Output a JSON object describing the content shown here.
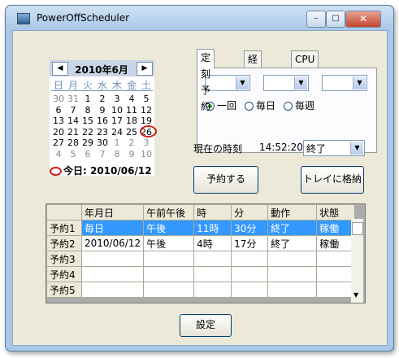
{
  "window": {
    "title": "PowerOffScheduler"
  },
  "calendar": {
    "month_label": "2010年6月",
    "weekdays": [
      "日",
      "月",
      "火",
      "水",
      "木",
      "金",
      "土"
    ],
    "weeks": [
      [
        "30",
        "31",
        "1",
        "2",
        "3",
        "4",
        "5"
      ],
      [
        "6",
        "7",
        "8",
        "9",
        "10",
        "11",
        "12"
      ],
      [
        "13",
        "14",
        "15",
        "16",
        "17",
        "18",
        "19"
      ],
      [
        "20",
        "21",
        "22",
        "23",
        "24",
        "25",
        "26"
      ],
      [
        "27",
        "28",
        "29",
        "30",
        "1",
        "2",
        "3"
      ],
      [
        "4",
        "5",
        "6",
        "7",
        "8",
        "9",
        "10"
      ]
    ],
    "today_label": "今日: 2010/06/12"
  },
  "tabs": [
    "定刻予約",
    "経過予約",
    "CPU使用率"
  ],
  "schedule_type": {
    "options": [
      "一回",
      "毎日",
      "毎週"
    ],
    "selected": "一回"
  },
  "clock": {
    "label": "現在の時刻",
    "time": "14:52:20",
    "action": "終了"
  },
  "buttons": {
    "reserve": "予約する",
    "tray": "トレイに格納",
    "settings": "設定"
  },
  "table": {
    "columns": [
      "年月日",
      "午前午後",
      "時",
      "分",
      "動作",
      "状態"
    ],
    "rows": [
      {
        "head": "予約1",
        "cells": [
          "毎日",
          "午後",
          "11時",
          "30分",
          "終了",
          "稼働"
        ]
      },
      {
        "head": "予約2",
        "cells": [
          "2010/06/12",
          "午後",
          "4時",
          "17分",
          "終了",
          "稼働"
        ]
      },
      {
        "head": "予約3",
        "cells": [
          "",
          "",
          "",
          "",
          "",
          ""
        ]
      },
      {
        "head": "予約4",
        "cells": [
          "",
          "",
          "",
          "",
          "",
          ""
        ]
      },
      {
        "head": "予約5",
        "cells": [
          "",
          "",
          "",
          "",
          "",
          ""
        ]
      }
    ]
  }
}
